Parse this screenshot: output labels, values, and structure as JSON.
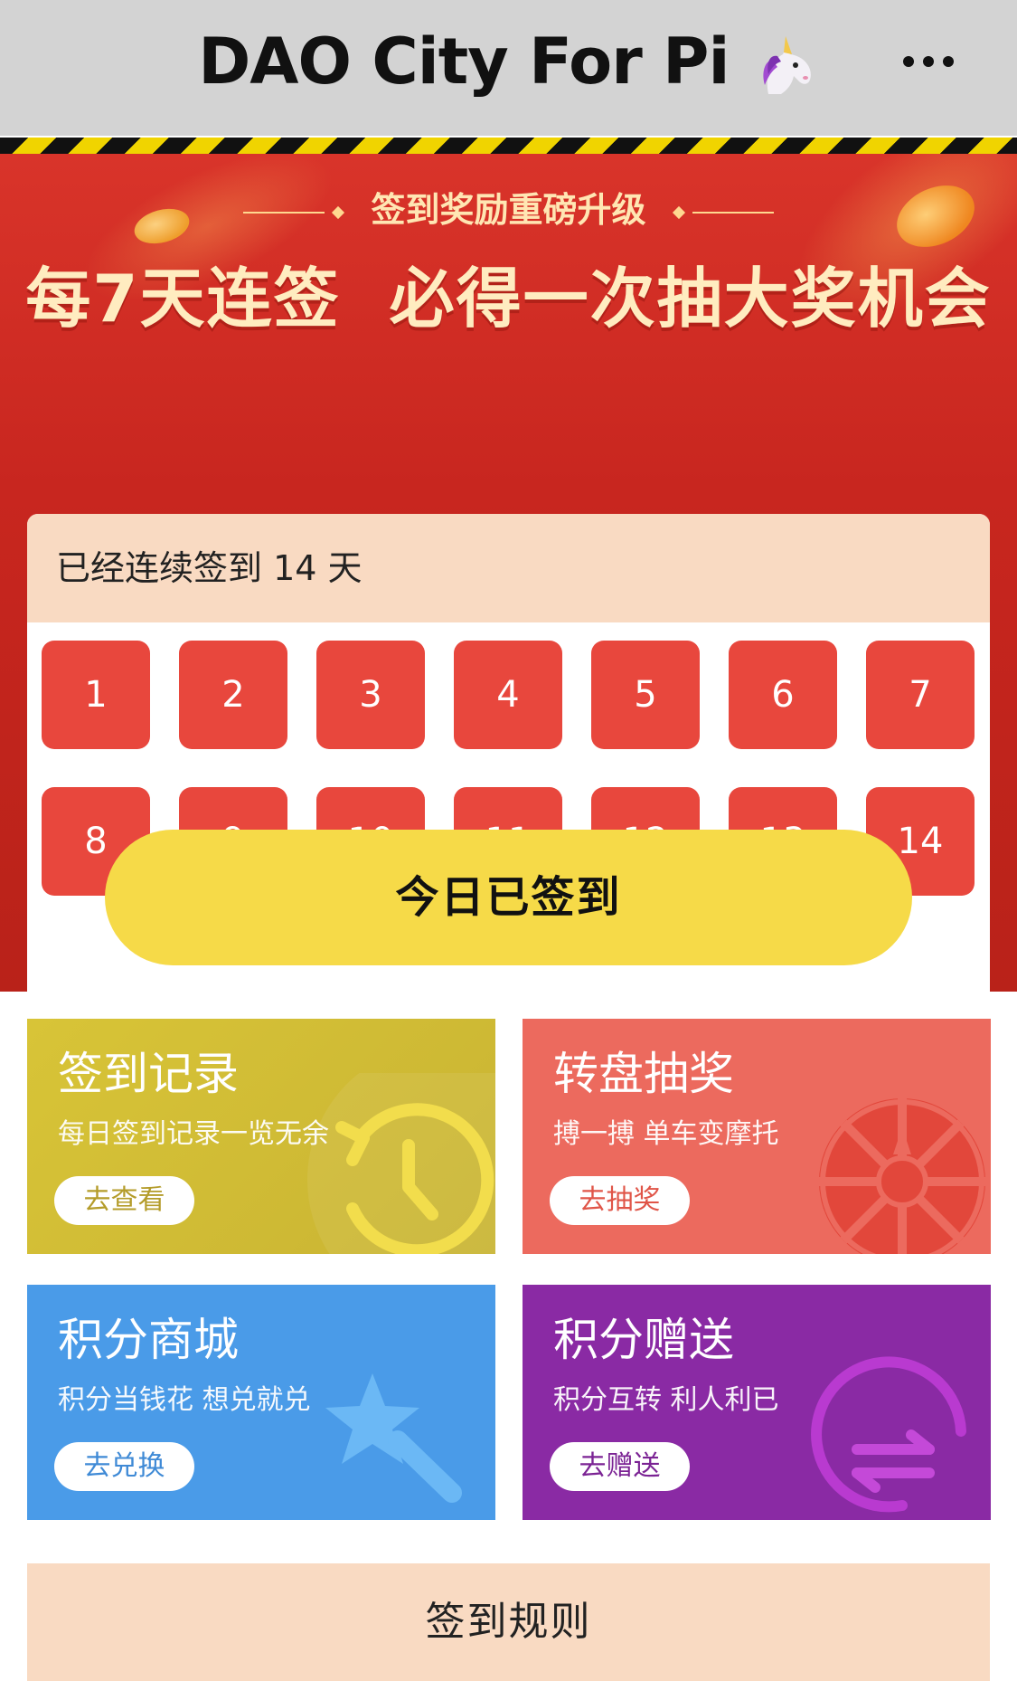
{
  "header": {
    "title": "DAO City For Pi",
    "title_emoji_icon": "unicorn-icon",
    "more_icon": "more-dots-icon"
  },
  "banner": {
    "subheading": "签到奖励重磅升级",
    "heading": "每7天连签  必得一次抽大奖机会"
  },
  "checkin": {
    "streak_text": "已经连续签到 14 天",
    "days": [
      "1",
      "2",
      "3",
      "4",
      "5",
      "6",
      "7",
      "8",
      "9",
      "10",
      "11",
      "12",
      "13",
      "14"
    ],
    "status_button": "今日已签到"
  },
  "tiles": [
    {
      "title": "签到记录",
      "subtitle": "每日签到记录一览无余",
      "button": "去查看",
      "icon": "clock-history-icon",
      "color": "#d8c437"
    },
    {
      "title": "转盘抽奖",
      "subtitle": "搏一搏 单车变摩托",
      "button": "去抽奖",
      "icon": "wheel-icon",
      "color": "#ec6a5e"
    },
    {
      "title": "积分商城",
      "subtitle": "积分当钱花 想兑就兑",
      "button": "去兑换",
      "icon": "magic-wand-icon",
      "color": "#4a9be8"
    },
    {
      "title": "积分赠送",
      "subtitle": "积分互转 利人利已",
      "button": "去赠送",
      "icon": "transfer-arrows-icon",
      "color": "#8a2aa4"
    }
  ],
  "footer": {
    "rules_label": "签到规则"
  },
  "colors": {
    "banner_red": "#c8261f",
    "day_red": "#e8473d",
    "button_yellow": "#f6da48",
    "peach": "#f9dac2"
  }
}
